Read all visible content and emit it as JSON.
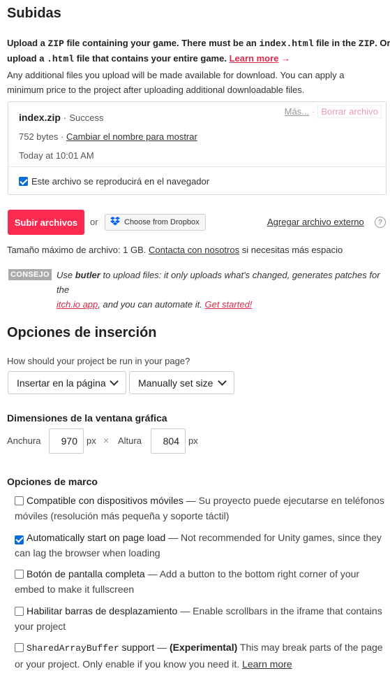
{
  "uploads": {
    "title": "Subidas",
    "intro_line1_a": "Upload a ",
    "intro_code_zip": "ZIP",
    "intro_line1_b": " file containing your game. There must be an ",
    "intro_code_index": "index.html",
    "intro_line1_c": " file in the ",
    "intro_code_zip2": "ZIP",
    "intro_line1_d": ". Or",
    "intro_line2_a": "upload a ",
    "intro_code_html": ".html",
    "intro_line2_b": " file that contains your entire game. ",
    "learn_more": "Learn more",
    "learn_more_arrow": "→",
    "extra_line1": "Any additional files you upload will be made available for download. You can apply a",
    "extra_line2": "minimum price to the project after uploading additional downloadable files.",
    "file": {
      "name": "index.zip",
      "status_sep": "·",
      "status": "Success",
      "more": "Más...",
      "more_sep": "·",
      "delete": "Borrar archivo",
      "size": "752 bytes",
      "size_sep": "·",
      "rename": "Cambiar el nombre para mostrar",
      "timestamp": "Today at 10:01 AM",
      "browser_playable_label": "Este archivo se reproducirá en el navegador",
      "browser_playable_checked": true
    },
    "upload_button": "Subir archivos",
    "or": "or",
    "dropbox_button": "Choose from Dropbox",
    "external_link": "Agregar archivo externo",
    "help": "?",
    "max_size_a": "Tamaño máximo de archivo: 1 GB. ",
    "max_size_contact": "Contacta con nosotros",
    "max_size_b": " si necesitas más espacio",
    "tip_badge": "CONSEJO",
    "tip_a": "Use ",
    "tip_butler": "butler",
    "tip_b": " to upload files: it only uploads what's changed, generates patches for the",
    "tip_app": "itch.io app",
    "tip_c": ", and you can automate it. ",
    "tip_started": "Get started!"
  },
  "embed": {
    "title": "Opciones de inserción",
    "question": "How should your project be run in your page?",
    "mode_select": "Insertar en la página",
    "size_select": "Manually set size",
    "viewport_title": "Dimensiones de la ventana gráfica",
    "width_label": "Anchura",
    "width_value": "970",
    "width_unit": "px",
    "times": "×",
    "height_label": "Altura",
    "height_value": "804",
    "height_unit": "px",
    "frame_title": "Opciones de marco",
    "options": [
      {
        "label": "Compatible con dispositivos móviles",
        "desc_line1": " — Su proyecto puede ejecutarse en teléfonos",
        "desc_line2": "móviles (resolución más pequeña y soporte táctil)",
        "checked": false
      },
      {
        "label": "Automatically start on page load",
        "desc_line1": " — Not recommended for Unity games, since they",
        "desc_line2": "can lag the browser when loading",
        "checked": true
      },
      {
        "label": "Botón de pantalla completa",
        "desc_line1": " — Add a button to the bottom right corner of your",
        "desc_line2": "embed to make it fullscreen",
        "checked": false
      },
      {
        "label": "Habilitar barras de desplazamiento",
        "desc_line1": " — Enable scrollbars in the iframe that contains",
        "desc_line2": "your project",
        "checked": false
      }
    ],
    "sab": {
      "code": "SharedArrayBuffer",
      "label_rest": " support",
      "dash": " — ",
      "experimental": "(Experimental)",
      "desc_line1": " This may break parts of the page",
      "desc_line2": "or your project. Only enable if you know you need it. ",
      "learn_more": "Learn more",
      "checked": false
    }
  },
  "colors": {
    "accent_red": "#fa2a50",
    "link_red": "#da2c4c",
    "checkbox_blue": "#0b6dd8",
    "delete_pink": "#e8a0ae"
  }
}
